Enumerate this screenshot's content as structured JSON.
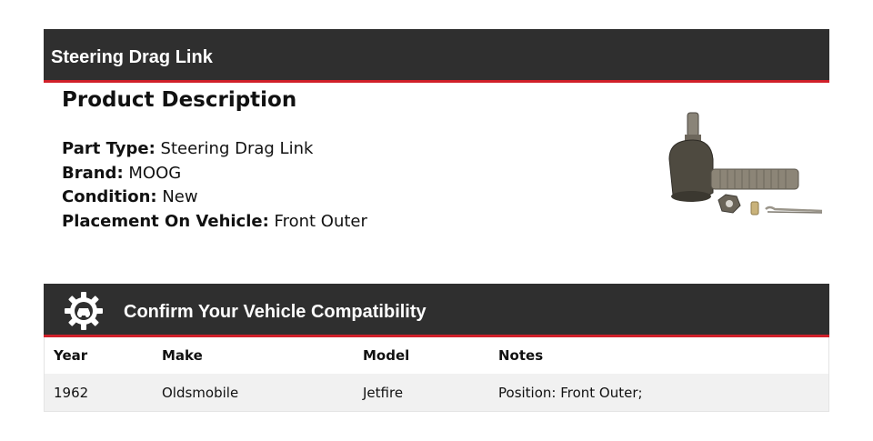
{
  "header": {
    "title": "Steering Drag Link"
  },
  "description": {
    "heading": "Product Description",
    "specs": [
      {
        "label": "Part Type:",
        "value": "Steering Drag Link"
      },
      {
        "label": "Brand:",
        "value": "MOOG"
      },
      {
        "label": "Condition:",
        "value": "New"
      },
      {
        "label": "Placement On Vehicle:",
        "value": "Front Outer"
      }
    ],
    "image_icon": "tie-rod-end-product-photo"
  },
  "compatibility": {
    "title": "Confirm Your Vehicle Compatibility",
    "icon": "gear-car-icon",
    "columns": [
      "Year",
      "Make",
      "Model",
      "Notes"
    ],
    "rows": [
      {
        "year": "1962",
        "make": "Oldsmobile",
        "model": "Jetfire",
        "notes": "Position: Front Outer;"
      }
    ]
  },
  "colors": {
    "bar": "#2f2f2f",
    "accent": "#d0202a"
  }
}
